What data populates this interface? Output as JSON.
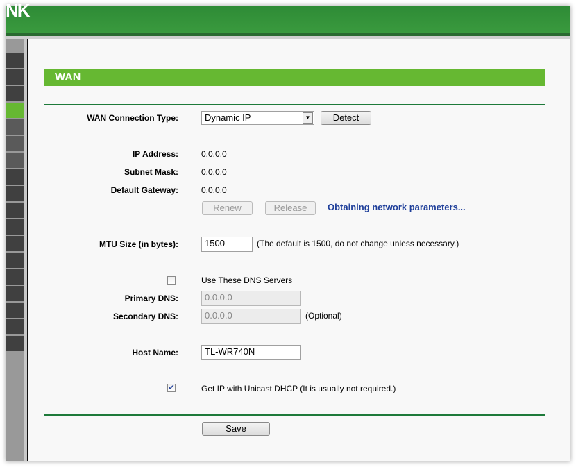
{
  "header": {
    "logo_text": "NK"
  },
  "sidebar": {
    "item_count": 18,
    "active_index": 3
  },
  "page": {
    "title": "WAN"
  },
  "form": {
    "connection_type_label": "WAN Connection Type:",
    "connection_type_value": "Dynamic IP",
    "detect_label": "Detect",
    "ip_label": "IP Address:",
    "ip_value": "0.0.0.0",
    "mask_label": "Subnet Mask:",
    "mask_value": "0.0.0.0",
    "gateway_label": "Default Gateway:",
    "gateway_value": "0.0.0.0",
    "renew_label": "Renew",
    "release_label": "Release",
    "status_text": "Obtaining network parameters...",
    "mtu_label": "MTU Size (in bytes):",
    "mtu_value": "1500",
    "mtu_hint": "(The default is 1500, do not change unless necessary.)",
    "use_dns_label": "Use These DNS Servers",
    "use_dns_checked": false,
    "primary_dns_label": "Primary DNS:",
    "primary_dns_value": "0.0.0.0",
    "secondary_dns_label": "Secondary DNS:",
    "secondary_dns_value": "0.0.0.0",
    "optional_text": "(Optional)",
    "host_name_label": "Host Name:",
    "host_name_value": "TL-WR740N",
    "unicast_label": "Get IP with Unicast DHCP (It is usually not required.)",
    "unicast_checked": true,
    "save_label": "Save"
  },
  "colors": {
    "brand": "#3a9a3e",
    "title_bar": "#66b832",
    "status": "#1f3f9a"
  }
}
